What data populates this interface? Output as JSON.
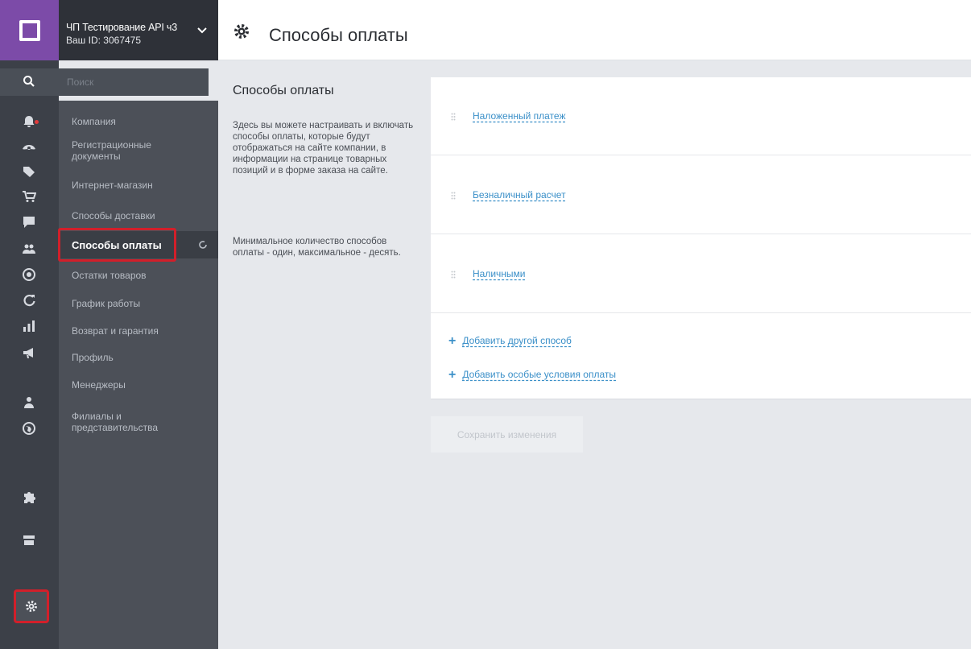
{
  "account": {
    "name": "ЧП Тестирование API ч3",
    "id_label": "Ваш ID: 3067475"
  },
  "search": {
    "placeholder": "Поиск"
  },
  "rail_icons": [
    "bell-icon",
    "eye-icon",
    "tag-icon",
    "cart-icon",
    "chat-icon",
    "users-icon",
    "target-icon",
    "refresh-icon",
    "chart-icon",
    "megaphone-icon",
    "person-icon",
    "globe-icon",
    "puzzle-icon",
    "store-icon",
    "gear-icon"
  ],
  "submenu": {
    "items": [
      {
        "label": "Компания"
      },
      {
        "label": "Регистрационные документы"
      },
      {
        "label": "Интернет-магазин"
      },
      {
        "label": "Способы доставки"
      },
      {
        "label": "Способы оплаты",
        "active": true
      },
      {
        "label": "Остатки товаров"
      },
      {
        "label": "График работы"
      },
      {
        "label": "Возврат и гарантия"
      },
      {
        "label": "Профиль"
      },
      {
        "label": "Менеджеры"
      },
      {
        "label": "Филиалы и представительства"
      }
    ]
  },
  "page": {
    "title": "Способы оплаты",
    "section_title": "Способы оплаты",
    "description": "Здесь вы можете настраивать и включать способы оплаты, которые будут отображаться на сайте компании, в информации на странице товарных позиций и в форме заказа на сайте.",
    "note": "Минимальное количество способов оплаты - один, максимальное - десять."
  },
  "payment_methods": [
    {
      "label": "Наложенный платеж"
    },
    {
      "label": "Безналичный расчет"
    },
    {
      "label": "Наличными"
    }
  ],
  "actions": {
    "add_method": "Добавить другой способ",
    "add_conditions": "Добавить особые условия оплаты",
    "save": "Сохранить изменения"
  },
  "colors": {
    "accent": "#3a8fc8",
    "brand": "#7c4ba8",
    "highlight": "#d21f2a"
  }
}
